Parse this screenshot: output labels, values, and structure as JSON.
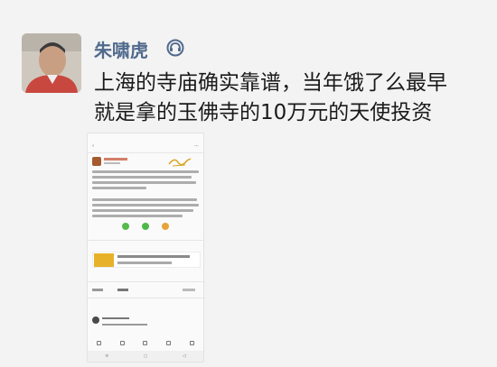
{
  "post": {
    "author": "朱啸虎",
    "text_line1": "上海的寺庙确实靠谱，当年饿了么最早",
    "text_line2": "就是拿的玉佛寺的10万元的天使投资"
  },
  "icons": {
    "author_icon": "headset-icon"
  },
  "colors": {
    "author_name": "#506a8d",
    "background": "#f3f3f3",
    "text": "#1a1a1a"
  }
}
